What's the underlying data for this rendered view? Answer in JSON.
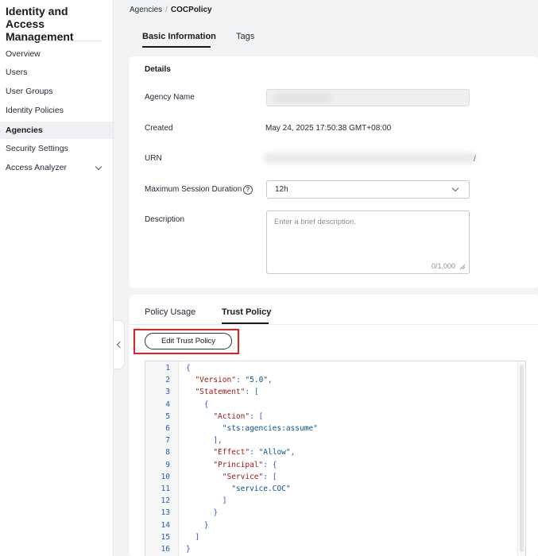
{
  "sidebar": {
    "title": "Identity and Access Management",
    "items": [
      {
        "label": "Overview"
      },
      {
        "label": "Users"
      },
      {
        "label": "User Groups"
      },
      {
        "label": "Identity Policies"
      },
      {
        "label": "Agencies",
        "active": true
      },
      {
        "label": "Security Settings"
      },
      {
        "label": "Access Analyzer",
        "expandable": true
      }
    ]
  },
  "breadcrumb": {
    "parent": "Agencies",
    "separator": "/",
    "current": "COCPolicy"
  },
  "tabs": {
    "basic": "Basic Information",
    "tags": "Tags",
    "active": "basic"
  },
  "details": {
    "title": "Details",
    "agency_name_label": "Agency Name",
    "created_label": "Created",
    "created_value": "May 24, 2025 17:50:38 GMT+08:00",
    "urn_label": "URN",
    "urn_tail": "/",
    "session_label": "Maximum Session Duration",
    "session_value": "12h",
    "description_label": "Description",
    "description_placeholder": "Enter a brief description.",
    "description_counter": "0/1,000"
  },
  "policy": {
    "tabs": {
      "usage": "Policy Usage",
      "trust": "Trust Policy",
      "active": "trust"
    },
    "edit_button": "Edit Trust Policy",
    "code_lines": [
      "{",
      "  \"Version\": \"5.0\",",
      "  \"Statement\": [",
      "    {",
      "      \"Action\": [",
      "        \"sts:agencies:assume\"",
      "      ],",
      "      \"Effect\": \"Allow\",",
      "      \"Principal\": {",
      "        \"Service\": [",
      "          \"service.COC\"",
      "        ]",
      "      }",
      "    }",
      "  ]",
      "}"
    ]
  },
  "colors": {
    "highlight": "#e02020",
    "code_keys": "#a31515",
    "code_strings": "#0b5394",
    "code_punctuation": "#2a56c6"
  }
}
